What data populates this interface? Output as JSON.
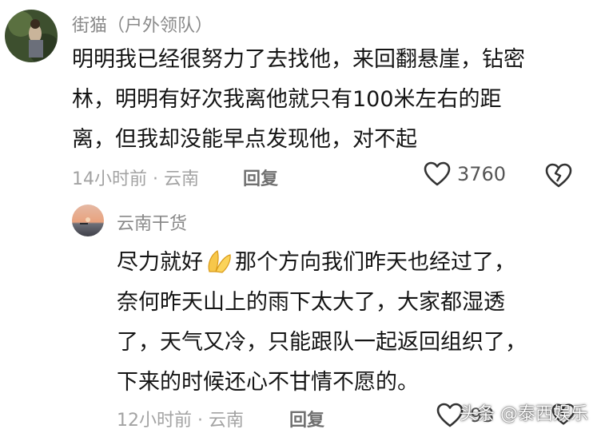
{
  "comments": [
    {
      "username": "街猫（户外领队）",
      "text_lines": [
        "明明我已经很努力了去找他，来回翻悬崖，钻密",
        "林，明明有好次我离他就只有100米左右的距",
        "离，但我却没能早点发现他，对不起"
      ],
      "meta": "14小时前 · 云南",
      "reply_label": "回复",
      "like_count": "3760"
    },
    {
      "username": "云南干货",
      "text_lines": [
        "尽力就好",
        "那个方向我们昨天也经过了，",
        "奈何昨天山上的雨下太大了，大家都湿透",
        "了，天气又冷，只能跟队一起返回组织了，",
        "下来的时候还心不甘情不愿的。"
      ],
      "meta": "12小时前 · 云南",
      "reply_label": "回复",
      "like_count": "93"
    }
  ],
  "watermark": "头条 @泰西娱乐",
  "icons": [
    "heart-outline-icon",
    "broken-heart-icon",
    "praying-hands-emoji-icon"
  ]
}
